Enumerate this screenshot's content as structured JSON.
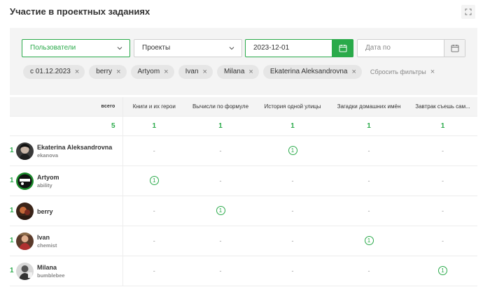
{
  "header": {
    "title": "Участие в проектных заданиях",
    "expand_icon": "fullscreen-icon"
  },
  "filters": {
    "users_select": "Пользователи",
    "projects_select": "Проекты",
    "date_from": "2023-12-01",
    "date_to_placeholder": "Дата по",
    "chips": [
      "с 01.12.2023",
      "berry",
      "Artyom",
      "Ivan",
      "Milana",
      "Ekaterina Aleksandrovna"
    ],
    "reset_label": "Сбросить фильтры",
    "accent_color": "#2aaa4a"
  },
  "table": {
    "total_header": "всего",
    "columns": [
      "Книги и их герои",
      "Вычисли по формуле",
      "История одной улицы",
      "Загадки домашних имён",
      "Завтрак съешь сам..."
    ],
    "totals": {
      "total": "5",
      "values": [
        "1",
        "1",
        "1",
        "1",
        "1"
      ]
    },
    "rows": [
      {
        "name": "Ekaterina Aleksandrovna",
        "login": "ekanova",
        "total": "1",
        "cells": [
          "-",
          "-",
          "1",
          "-",
          "-"
        ]
      },
      {
        "name": "Artyom",
        "login": "ability",
        "total": "1",
        "cells": [
          "1",
          "-",
          "-",
          "-",
          "-"
        ]
      },
      {
        "name": "berry",
        "login": "",
        "total": "1",
        "cells": [
          "-",
          "1",
          "-",
          "-",
          "-"
        ]
      },
      {
        "name": "Ivan",
        "login": "chemist",
        "total": "1",
        "cells": [
          "-",
          "-",
          "-",
          "1",
          "-"
        ]
      },
      {
        "name": "Milana",
        "login": "bumblebee",
        "total": "1",
        "cells": [
          "-",
          "-",
          "-",
          "-",
          "1"
        ]
      }
    ]
  }
}
